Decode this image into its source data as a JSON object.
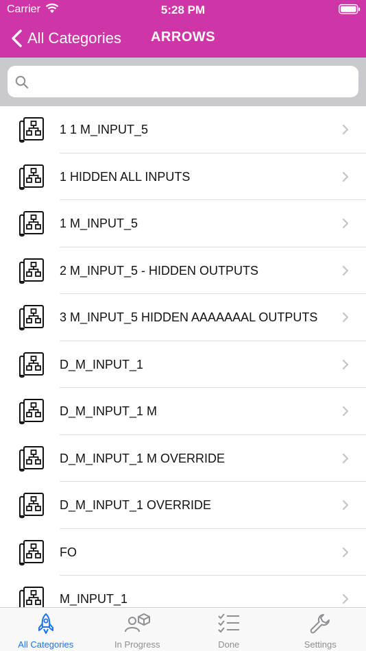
{
  "status_bar": {
    "carrier": "Carrier",
    "time": "5:28 PM"
  },
  "nav": {
    "back_label": "All Categories",
    "title": "ARROWS"
  },
  "search": {
    "placeholder": "",
    "value": ""
  },
  "items": [
    {
      "label": "1 1 M_INPUT_5"
    },
    {
      "label": "1 HIDDEN ALL INPUTS"
    },
    {
      "label": "1 M_INPUT_5"
    },
    {
      "label": "2 M_INPUT_5 - HIDDEN OUTPUTS"
    },
    {
      "label": "3 M_INPUT_5 HIDDEN AAAAAAAL OUTPUTS"
    },
    {
      "label": "D_M_INPUT_1"
    },
    {
      "label": "D_M_INPUT_1 M"
    },
    {
      "label": "D_M_INPUT_1 M OVERRIDE"
    },
    {
      "label": "D_M_INPUT_1 OVERRIDE"
    },
    {
      "label": "FO"
    },
    {
      "label": "M_INPUT_1"
    }
  ],
  "tabs": [
    {
      "label": "All Categories",
      "icon": "rocket-icon",
      "active": true
    },
    {
      "label": "In Progress",
      "icon": "person-box-icon",
      "active": false
    },
    {
      "label": "Done",
      "icon": "checklist-icon",
      "active": false
    },
    {
      "label": "Settings",
      "icon": "wrench-icon",
      "active": false
    }
  ],
  "colors": {
    "accent": "#d035a8",
    "tab_active": "#1a73e8",
    "tab_inactive": "#8e8e93"
  }
}
